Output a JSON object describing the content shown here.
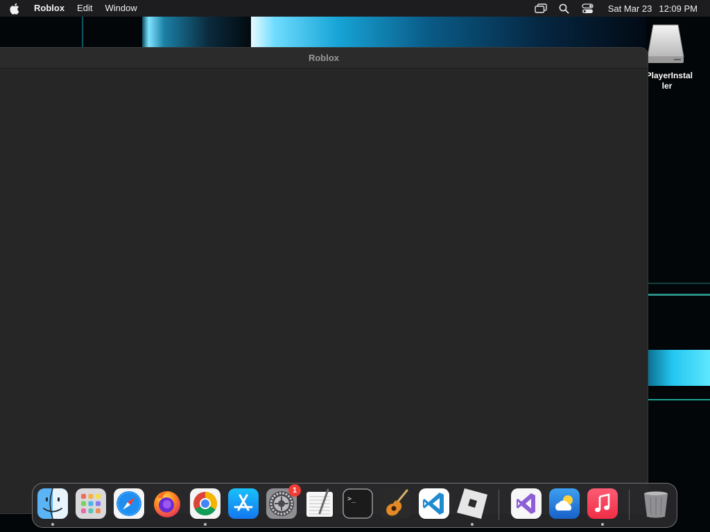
{
  "menubar": {
    "app_name": "Roblox",
    "items": [
      {
        "label": "Edit"
      },
      {
        "label": "Window"
      }
    ],
    "status_icons": [
      "screen-mirroring-icon",
      "search-icon",
      "control-center-icon"
    ],
    "date": "Sat Mar 23",
    "time": "12:09 PM"
  },
  "desktop": {
    "icons": [
      {
        "label": "xPlayerInstal\nler",
        "icon": "disk-image-icon"
      }
    ]
  },
  "window": {
    "title": "Roblox",
    "background": "#262626"
  },
  "dock": {
    "apps": [
      {
        "name": "Finder",
        "icon": "finder-icon",
        "running": true
      },
      {
        "name": "Launchpad",
        "icon": "launchpad-icon",
        "running": false
      },
      {
        "name": "Safari",
        "icon": "safari-icon",
        "running": false
      },
      {
        "name": "Firefox",
        "icon": "firefox-icon",
        "running": false
      },
      {
        "name": "Google Chrome",
        "icon": "chrome-icon",
        "running": true
      },
      {
        "name": "App Store",
        "icon": "app-store-icon",
        "running": false
      },
      {
        "name": "System Preferences",
        "icon": "system-preferences-icon",
        "running": false,
        "badge": "1"
      },
      {
        "name": "TextEdit",
        "icon": "textedit-icon",
        "running": false
      },
      {
        "name": "Terminal",
        "icon": "terminal-icon",
        "running": false
      },
      {
        "name": "GarageBand",
        "icon": "garageband-icon",
        "running": false
      },
      {
        "name": "Visual Studio Code",
        "icon": "vscode-icon",
        "running": false
      },
      {
        "name": "Roblox",
        "icon": "roblox-icon",
        "running": true
      },
      {
        "name": "Visual Studio",
        "icon": "visual-studio-icon",
        "running": false
      },
      {
        "name": "Weather",
        "icon": "weather-icon",
        "running": false
      },
      {
        "name": "Music",
        "icon": "music-icon",
        "running": true
      },
      {
        "name": "Trash",
        "icon": "trash-icon",
        "running": false
      }
    ]
  }
}
